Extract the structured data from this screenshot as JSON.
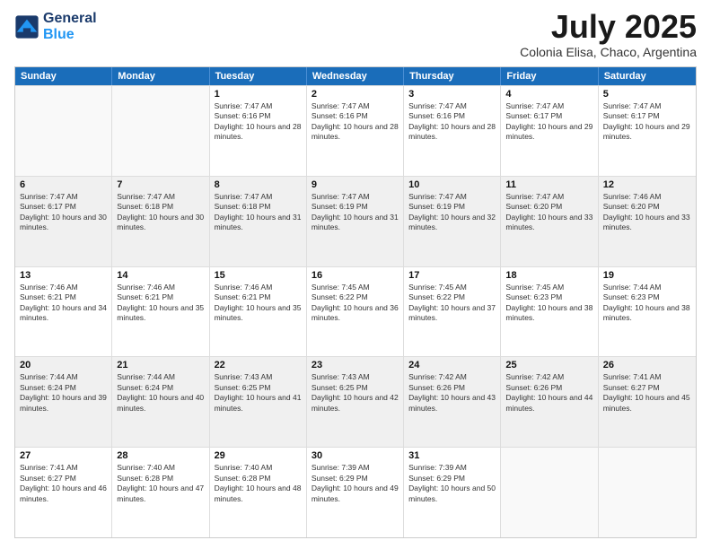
{
  "header": {
    "logo_line1": "General",
    "logo_line2": "Blue",
    "title": "July 2025",
    "subtitle": "Colonia Elisa, Chaco, Argentina"
  },
  "calendar": {
    "days": [
      "Sunday",
      "Monday",
      "Tuesday",
      "Wednesday",
      "Thursday",
      "Friday",
      "Saturday"
    ],
    "rows": [
      [
        {
          "day": "",
          "empty": true
        },
        {
          "day": "",
          "empty": true
        },
        {
          "day": "1",
          "sunrise": "Sunrise: 7:47 AM",
          "sunset": "Sunset: 6:16 PM",
          "daylight": "Daylight: 10 hours and 28 minutes."
        },
        {
          "day": "2",
          "sunrise": "Sunrise: 7:47 AM",
          "sunset": "Sunset: 6:16 PM",
          "daylight": "Daylight: 10 hours and 28 minutes."
        },
        {
          "day": "3",
          "sunrise": "Sunrise: 7:47 AM",
          "sunset": "Sunset: 6:16 PM",
          "daylight": "Daylight: 10 hours and 28 minutes."
        },
        {
          "day": "4",
          "sunrise": "Sunrise: 7:47 AM",
          "sunset": "Sunset: 6:17 PM",
          "daylight": "Daylight: 10 hours and 29 minutes."
        },
        {
          "day": "5",
          "sunrise": "Sunrise: 7:47 AM",
          "sunset": "Sunset: 6:17 PM",
          "daylight": "Daylight: 10 hours and 29 minutes."
        }
      ],
      [
        {
          "day": "6",
          "sunrise": "Sunrise: 7:47 AM",
          "sunset": "Sunset: 6:17 PM",
          "daylight": "Daylight: 10 hours and 30 minutes.",
          "shaded": true
        },
        {
          "day": "7",
          "sunrise": "Sunrise: 7:47 AM",
          "sunset": "Sunset: 6:18 PM",
          "daylight": "Daylight: 10 hours and 30 minutes.",
          "shaded": true
        },
        {
          "day": "8",
          "sunrise": "Sunrise: 7:47 AM",
          "sunset": "Sunset: 6:18 PM",
          "daylight": "Daylight: 10 hours and 31 minutes.",
          "shaded": true
        },
        {
          "day": "9",
          "sunrise": "Sunrise: 7:47 AM",
          "sunset": "Sunset: 6:19 PM",
          "daylight": "Daylight: 10 hours and 31 minutes.",
          "shaded": true
        },
        {
          "day": "10",
          "sunrise": "Sunrise: 7:47 AM",
          "sunset": "Sunset: 6:19 PM",
          "daylight": "Daylight: 10 hours and 32 minutes.",
          "shaded": true
        },
        {
          "day": "11",
          "sunrise": "Sunrise: 7:47 AM",
          "sunset": "Sunset: 6:20 PM",
          "daylight": "Daylight: 10 hours and 33 minutes.",
          "shaded": true
        },
        {
          "day": "12",
          "sunrise": "Sunrise: 7:46 AM",
          "sunset": "Sunset: 6:20 PM",
          "daylight": "Daylight: 10 hours and 33 minutes.",
          "shaded": true
        }
      ],
      [
        {
          "day": "13",
          "sunrise": "Sunrise: 7:46 AM",
          "sunset": "Sunset: 6:21 PM",
          "daylight": "Daylight: 10 hours and 34 minutes."
        },
        {
          "day": "14",
          "sunrise": "Sunrise: 7:46 AM",
          "sunset": "Sunset: 6:21 PM",
          "daylight": "Daylight: 10 hours and 35 minutes."
        },
        {
          "day": "15",
          "sunrise": "Sunrise: 7:46 AM",
          "sunset": "Sunset: 6:21 PM",
          "daylight": "Daylight: 10 hours and 35 minutes."
        },
        {
          "day": "16",
          "sunrise": "Sunrise: 7:45 AM",
          "sunset": "Sunset: 6:22 PM",
          "daylight": "Daylight: 10 hours and 36 minutes."
        },
        {
          "day": "17",
          "sunrise": "Sunrise: 7:45 AM",
          "sunset": "Sunset: 6:22 PM",
          "daylight": "Daylight: 10 hours and 37 minutes."
        },
        {
          "day": "18",
          "sunrise": "Sunrise: 7:45 AM",
          "sunset": "Sunset: 6:23 PM",
          "daylight": "Daylight: 10 hours and 38 minutes."
        },
        {
          "day": "19",
          "sunrise": "Sunrise: 7:44 AM",
          "sunset": "Sunset: 6:23 PM",
          "daylight": "Daylight: 10 hours and 38 minutes."
        }
      ],
      [
        {
          "day": "20",
          "sunrise": "Sunrise: 7:44 AM",
          "sunset": "Sunset: 6:24 PM",
          "daylight": "Daylight: 10 hours and 39 minutes.",
          "shaded": true
        },
        {
          "day": "21",
          "sunrise": "Sunrise: 7:44 AM",
          "sunset": "Sunset: 6:24 PM",
          "daylight": "Daylight: 10 hours and 40 minutes.",
          "shaded": true
        },
        {
          "day": "22",
          "sunrise": "Sunrise: 7:43 AM",
          "sunset": "Sunset: 6:25 PM",
          "daylight": "Daylight: 10 hours and 41 minutes.",
          "shaded": true
        },
        {
          "day": "23",
          "sunrise": "Sunrise: 7:43 AM",
          "sunset": "Sunset: 6:25 PM",
          "daylight": "Daylight: 10 hours and 42 minutes.",
          "shaded": true
        },
        {
          "day": "24",
          "sunrise": "Sunrise: 7:42 AM",
          "sunset": "Sunset: 6:26 PM",
          "daylight": "Daylight: 10 hours and 43 minutes.",
          "shaded": true
        },
        {
          "day": "25",
          "sunrise": "Sunrise: 7:42 AM",
          "sunset": "Sunset: 6:26 PM",
          "daylight": "Daylight: 10 hours and 44 minutes.",
          "shaded": true
        },
        {
          "day": "26",
          "sunrise": "Sunrise: 7:41 AM",
          "sunset": "Sunset: 6:27 PM",
          "daylight": "Daylight: 10 hours and 45 minutes.",
          "shaded": true
        }
      ],
      [
        {
          "day": "27",
          "sunrise": "Sunrise: 7:41 AM",
          "sunset": "Sunset: 6:27 PM",
          "daylight": "Daylight: 10 hours and 46 minutes."
        },
        {
          "day": "28",
          "sunrise": "Sunrise: 7:40 AM",
          "sunset": "Sunset: 6:28 PM",
          "daylight": "Daylight: 10 hours and 47 minutes."
        },
        {
          "day": "29",
          "sunrise": "Sunrise: 7:40 AM",
          "sunset": "Sunset: 6:28 PM",
          "daylight": "Daylight: 10 hours and 48 minutes."
        },
        {
          "day": "30",
          "sunrise": "Sunrise: 7:39 AM",
          "sunset": "Sunset: 6:29 PM",
          "daylight": "Daylight: 10 hours and 49 minutes."
        },
        {
          "day": "31",
          "sunrise": "Sunrise: 7:39 AM",
          "sunset": "Sunset: 6:29 PM",
          "daylight": "Daylight: 10 hours and 50 minutes."
        },
        {
          "day": "",
          "empty": true
        },
        {
          "day": "",
          "empty": true
        }
      ]
    ]
  }
}
